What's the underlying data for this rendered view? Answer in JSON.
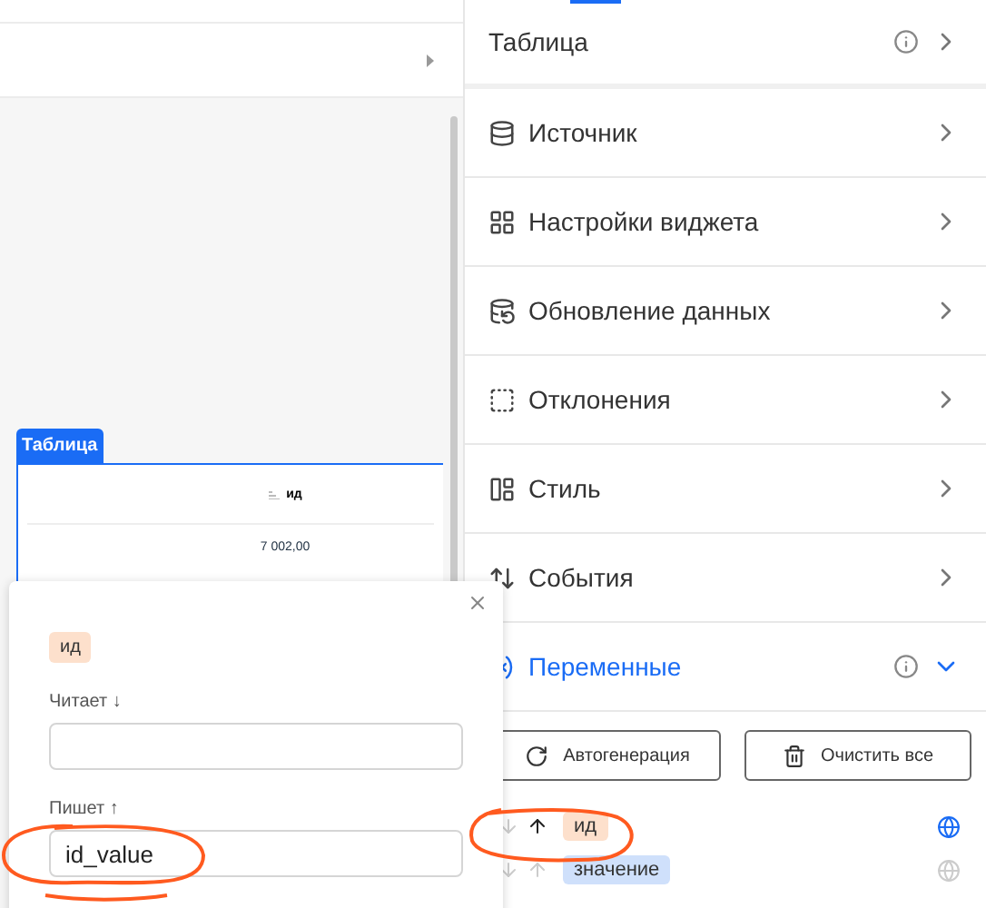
{
  "widget": {
    "tab": "Таблица",
    "column": "ид",
    "cell": "7 002,00"
  },
  "popup": {
    "tag": "ид",
    "reads_label": "Читает ↓",
    "writes_label": "Пишет ↑",
    "writes_value": "id_value"
  },
  "panel": {
    "title": "Таблица",
    "sections": [
      {
        "label": "Источник",
        "expanded": false
      },
      {
        "label": "Настройки виджета",
        "expanded": false
      },
      {
        "label": "Обновление данных",
        "expanded": false
      },
      {
        "label": "Отклонения",
        "expanded": false
      },
      {
        "label": "Стиль",
        "expanded": false
      },
      {
        "label": "События",
        "expanded": false
      },
      {
        "label": "Переменные",
        "expanded": true,
        "info": true
      }
    ],
    "buttons": [
      {
        "label": "Автогенерация"
      },
      {
        "label": "Очистить все"
      }
    ],
    "variables": [
      {
        "name": "ид",
        "reads": false,
        "writes": true,
        "global": true,
        "color": "#fde0cc"
      },
      {
        "name": "значение",
        "reads": false,
        "writes": false,
        "global": false,
        "color": "#cfe0fb"
      }
    ]
  }
}
